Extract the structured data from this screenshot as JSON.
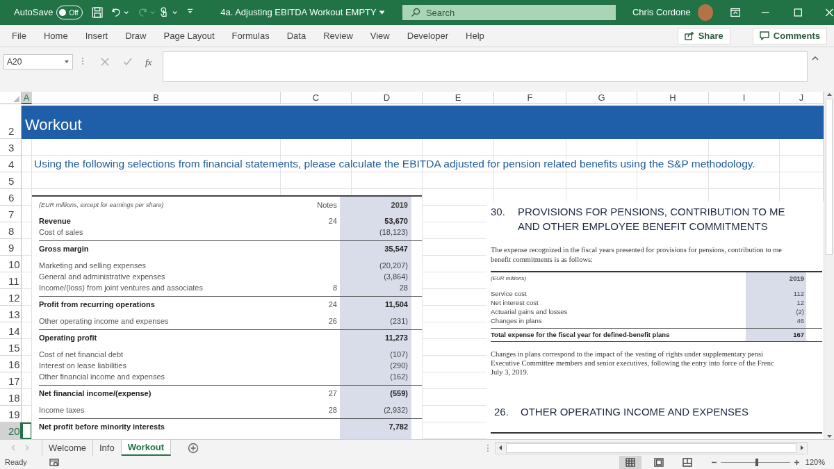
{
  "title_bar": {
    "autosave": {
      "label": "AutoSave",
      "on": false,
      "state_text": "Off"
    },
    "quick_access": [
      {
        "kind": "save",
        "disabled": false,
        "dropdown": false
      },
      {
        "kind": "undo",
        "disabled": false,
        "dropdown": true
      },
      {
        "kind": "redo",
        "disabled": true,
        "dropdown": true
      },
      {
        "kind": "touch",
        "disabled": false,
        "dropdown": true
      },
      {
        "kind": "customize",
        "disabled": false,
        "dropdown": false
      }
    ],
    "document_title": "4a. Adjusting EBITDA Workout EMPTY",
    "search": {
      "placeholder": "Search"
    },
    "user_name": "Chris Cordone"
  },
  "ribbon": {
    "tabs": [
      {
        "label": "File"
      },
      {
        "label": "Home"
      },
      {
        "label": "Insert"
      },
      {
        "label": "Draw"
      },
      {
        "label": "Page Layout"
      },
      {
        "label": "Formulas"
      },
      {
        "label": "Data"
      },
      {
        "label": "Review"
      },
      {
        "label": "View"
      },
      {
        "label": "Developer"
      },
      {
        "label": "Help"
      }
    ],
    "share": "Share",
    "comments": "Comments"
  },
  "formula_bar": {
    "name_box": "A20",
    "function_label": "fx"
  },
  "columns": [
    {
      "label": "A",
      "selected": true
    },
    {
      "label": "B",
      "selected": false
    },
    {
      "label": "C",
      "selected": false
    },
    {
      "label": "D",
      "selected": false
    },
    {
      "label": "E",
      "selected": false
    },
    {
      "label": "F",
      "selected": false
    },
    {
      "label": "G",
      "selected": false
    },
    {
      "label": "H",
      "selected": false
    },
    {
      "label": "I",
      "selected": false
    },
    {
      "label": "J",
      "selected": false
    }
  ],
  "rows": [
    {
      "label": "2",
      "selected": false
    },
    {
      "label": "3",
      "selected": false
    },
    {
      "label": "4",
      "selected": false
    },
    {
      "label": "5",
      "selected": false
    },
    {
      "label": "6",
      "selected": false
    },
    {
      "label": "7",
      "selected": false
    },
    {
      "label": "8",
      "selected": false
    },
    {
      "label": "9",
      "selected": false
    },
    {
      "label": "10",
      "selected": false
    },
    {
      "label": "11",
      "selected": false
    },
    {
      "label": "12",
      "selected": false
    },
    {
      "label": "13",
      "selected": false
    },
    {
      "label": "14",
      "selected": false
    },
    {
      "label": "15",
      "selected": false
    },
    {
      "label": "16",
      "selected": false
    },
    {
      "label": "17",
      "selected": false
    },
    {
      "label": "18",
      "selected": false
    },
    {
      "label": "19",
      "selected": false
    },
    {
      "label": "20",
      "selected": true
    }
  ],
  "sheet_title": "Workout",
  "instruction": "Using the following selections from financial statements, please calculate the EBITDA adjusted for pension related benefits using the S&P methodology.",
  "income_statement": {
    "caption": "(EUR millions, except for earnings per share)",
    "notes_heading": "Notes",
    "year": "2019",
    "groups": [
      [
        {
          "label": "Revenue",
          "note": "24",
          "value": "53,670",
          "bold": true,
          "rule_above": false
        },
        {
          "label": "Cost of sales",
          "value": "(18,123)",
          "bold": false,
          "rule_above": false
        }
      ],
      [
        {
          "label": "Gross margin",
          "value": "35,547",
          "bold": true,
          "rule_above": true
        }
      ],
      [
        {
          "label": "Marketing and selling expenses",
          "value": "(20,207)",
          "bold": false,
          "rule_above": false
        },
        {
          "label": "General and administrative expenses",
          "value": "(3,864)",
          "bold": false,
          "rule_above": false
        },
        {
          "label": "Income/(loss) from joint ventures and associates",
          "note": "8",
          "value": "28",
          "bold": false,
          "rule_above": false
        }
      ],
      [
        {
          "label": "Profit from recurring operations",
          "note": "24",
          "value": "11,504",
          "bold": true,
          "rule_above": true
        }
      ],
      [
        {
          "label": "Other operating income and expenses",
          "note": "26",
          "value": "(231)",
          "bold": false,
          "rule_above": false
        }
      ],
      [
        {
          "label": "Operating profit",
          "value": "11,273",
          "bold": true,
          "rule_above": true
        }
      ],
      [
        {
          "label": "Cost of net financial debt",
          "value": "(107)",
          "bold": false,
          "rule_above": false
        },
        {
          "label": "Interest on lease liabilities",
          "value": "(290)",
          "bold": false,
          "rule_above": false
        },
        {
          "label": "Other financial income and expenses",
          "value": "(162)",
          "bold": false,
          "rule_above": false
        }
      ],
      [
        {
          "label": "Net financial income/(expense)",
          "note": "27",
          "value": "(559)",
          "bold": true,
          "rule_above": true
        }
      ],
      [
        {
          "label": "Income taxes",
          "note": "28",
          "value": "(2,932)",
          "bold": false,
          "rule_above": false
        }
      ],
      [
        {
          "label": "Net profit before minority interests",
          "value": "7,782",
          "bold": true,
          "rule_above": true
        }
      ]
    ]
  },
  "pension_note": {
    "number": "30.",
    "title_lines": [
      "PROVISIONS FOR PENSIONS, CONTRIBUTION TO ME",
      "AND OTHER EMPLOYEE BENEFIT COMMITMENTS"
    ],
    "intro_lines": [
      "The expense recognized in the fiscal years presented for provisions for pensions, contribution to me",
      "benefit commitments is as follows:"
    ],
    "caption": "(EUR millions)",
    "year": "2019",
    "rows": [
      {
        "label": "Service cost",
        "value": "112"
      },
      {
        "label": "Net interest cost",
        "value": "12"
      },
      {
        "label": "Actuarial gains and losses",
        "value": "(2)"
      },
      {
        "label": "Changes in plans",
        "value": "46"
      }
    ],
    "total": {
      "label": "Total expense for the fiscal year for defined-benefit plans",
      "value": "167"
    },
    "remark_lines": [
      "Changes in plans correspond to the impact of the vesting of rights under supplementary pensi",
      "Executive Committee members and senior executives, following the entry into force of the Frenc",
      "July 3, 2019."
    ]
  },
  "next_note": {
    "number": "26.",
    "title": "OTHER OPERATING INCOME AND EXPENSES"
  },
  "sheet_tabs": [
    {
      "label": "Welcome",
      "selected": false
    },
    {
      "label": "Info",
      "selected": false
    },
    {
      "label": "Workout",
      "selected": true
    }
  ],
  "status_bar": {
    "status": "Ready",
    "views": [
      {
        "kind": "normal",
        "selected": true
      },
      {
        "kind": "page_layout",
        "selected": false
      },
      {
        "kind": "page_break",
        "selected": false
      }
    ],
    "zoom": {
      "level": 0.52,
      "reading": "120%"
    }
  }
}
